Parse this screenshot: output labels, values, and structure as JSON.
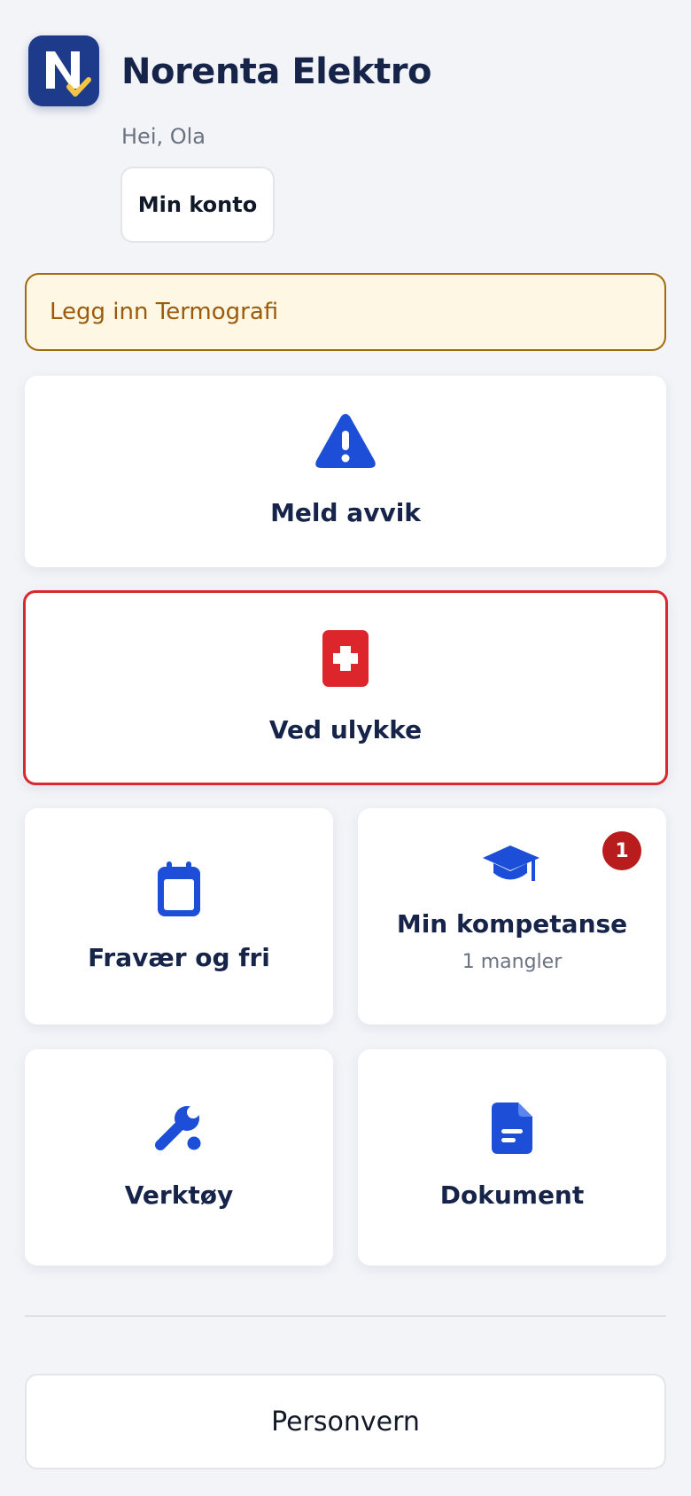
{
  "header": {
    "brand": "Norenta Elektro",
    "greeting": "Hei, Ola",
    "account_button": "Min konto"
  },
  "alert": {
    "text": "Legg inn Termografi"
  },
  "cards": {
    "avvik": {
      "title": "Meld avvik",
      "icon": "warning-icon"
    },
    "ulykke": {
      "title": "Ved ulykke",
      "icon": "first-aid-icon"
    },
    "fravaer": {
      "title": "Fravær og fri",
      "icon": "calendar-icon"
    },
    "kompetanse": {
      "title": "Min kompetanse",
      "subtitle": "1 mangler",
      "badge": "1",
      "icon": "graduation-cap-icon"
    },
    "verktoy": {
      "title": "Verktøy",
      "icon": "wrench-icon"
    },
    "dokument": {
      "title": "Dokument",
      "icon": "document-icon"
    }
  },
  "footer": {
    "privacy_button": "Personvern"
  },
  "colors": {
    "accent": "#1d4ed8",
    "danger": "#d42a30",
    "warning_bg": "#fdf7e3",
    "warning_text": "#9a5b0c",
    "navy": "#16244a"
  }
}
